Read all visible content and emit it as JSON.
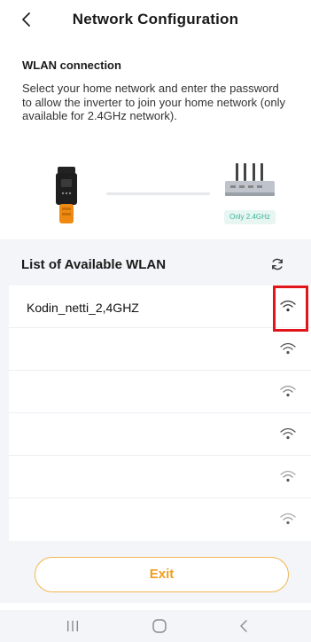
{
  "header": {
    "title": "Network Configuration"
  },
  "intro": {
    "section_title": "WLAN connection",
    "description": "Select your home network and enter the password to allow the inverter to join your home network (only available for 2.4GHz network)."
  },
  "illustration": {
    "router_badge": "Only 2.4GHz"
  },
  "wlan_list": {
    "title": "List of Available WLAN",
    "networks": [
      {
        "ssid": "Kodin_netti_2,4GHZ",
        "icon": "wifi-icon"
      },
      {
        "ssid": "",
        "icon": "wifi-icon"
      },
      {
        "ssid": "",
        "icon": "wifi-icon"
      },
      {
        "ssid": "",
        "icon": "wifi-icon"
      },
      {
        "ssid": "",
        "icon": "wifi-icon"
      },
      {
        "ssid": "",
        "icon": "wifi-icon"
      }
    ]
  },
  "footer": {
    "exit_label": "Exit"
  },
  "colors": {
    "accent": "#f29d1c",
    "highlight": "#e0161a",
    "badge_text": "#3bb398"
  }
}
